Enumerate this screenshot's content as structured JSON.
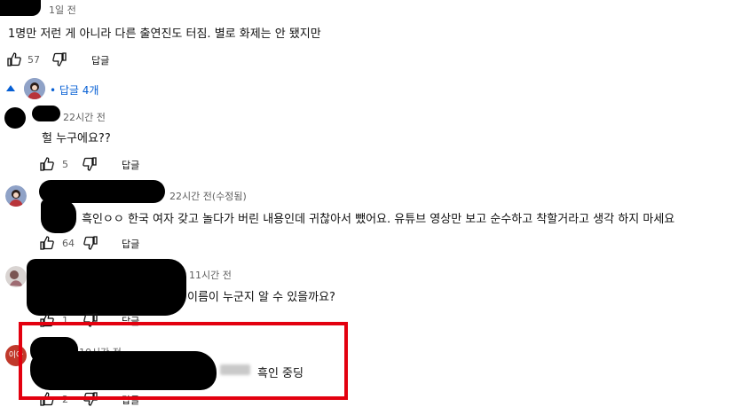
{
  "top_comment": {
    "time": "1일 전",
    "text": "1명만 저런 게 아니라 다른 출연진도 터짐. 별로 화제는 안 됐지만",
    "likes": "57",
    "reply_label": "답글"
  },
  "replies_toggle": {
    "label": "• 답글 4개"
  },
  "replies": [
    {
      "time": "22시간 전",
      "text": "헐 누구에요??",
      "likes": "5",
      "reply_label": "답글"
    },
    {
      "time": "22시간 전(수정됨)",
      "text": "흑인ㅇㅇ 한국 여자 갖고 놀다가 버린 내용인데 귀찮아서 뺐어요. 유튜브 영상만 보고 순수하고 착할거라고 생각 하지 마세요",
      "likes": "64",
      "reply_label": "답글"
    },
    {
      "time": "11시간 전",
      "text": "이름이 누군지 알 수 있을까요?",
      "likes": "1",
      "reply_label": "답글"
    },
    {
      "time": "10시간 전",
      "text": "흑인 중딩",
      "avatar_text": "이아",
      "likes": "2",
      "reply_label": "답글"
    }
  ],
  "colors": {
    "highlight": "#e3000f",
    "avatar_orange": "#c0392b"
  }
}
